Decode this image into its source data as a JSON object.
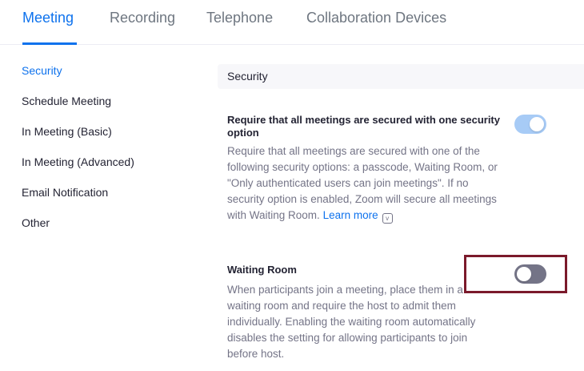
{
  "tabs": [
    {
      "label": "Meeting",
      "active": true
    },
    {
      "label": "Recording",
      "active": false
    },
    {
      "label": "Telephone",
      "active": false
    },
    {
      "label": "Collaboration Devices",
      "active": false
    }
  ],
  "sidebar": {
    "items": [
      {
        "label": "Security",
        "active": true
      },
      {
        "label": "Schedule Meeting",
        "active": false
      },
      {
        "label": "In Meeting (Basic)",
        "active": false
      },
      {
        "label": "In Meeting (Advanced)",
        "active": false
      },
      {
        "label": "Email Notification",
        "active": false
      },
      {
        "label": "Other",
        "active": false
      }
    ]
  },
  "section": {
    "title": "Security"
  },
  "settings": [
    {
      "title": "Require that all meetings are secured with one security option",
      "description": "Require that all meetings are secured with one of the following security options: a passcode, Waiting Room, or \"Only authenticated users can join meetings\". If no security option is enabled, Zoom will secure all meetings with Waiting Room.",
      "link": "Learn more",
      "info_icon": "info-icon",
      "enabled": true
    },
    {
      "title": "Waiting Room",
      "description": "When participants join a meeting, place them in a waiting room and require the host to admit them individually. Enabling the waiting room automatically disables the setting for allowing participants to join before host.",
      "enabled": false,
      "highlighted": true
    }
  ],
  "colors": {
    "accent": "#0e72ed",
    "toggle_on": "#a7cbf6",
    "toggle_off": "#747487",
    "highlight": "#7b1a2b"
  }
}
